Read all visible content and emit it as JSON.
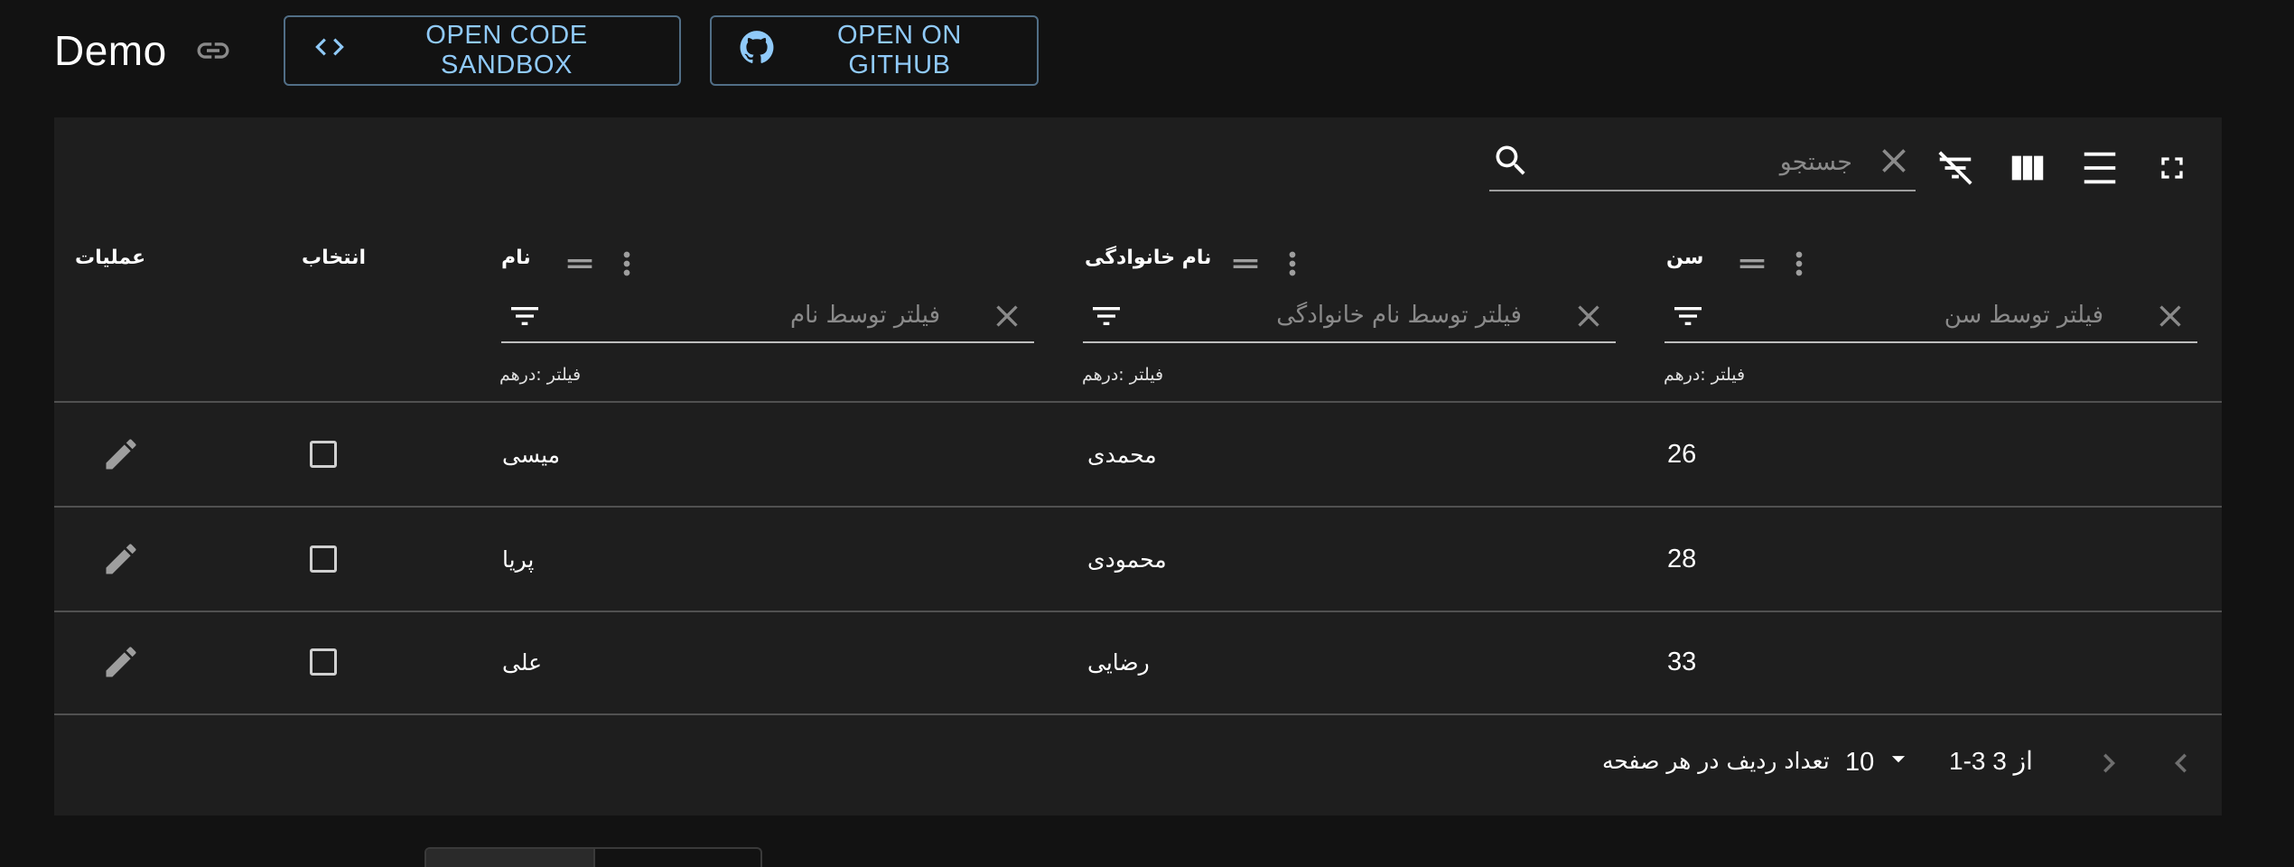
{
  "page": {
    "title": "Demo"
  },
  "buttons": {
    "sandbox": "OPEN CODE SANDBOX",
    "github": "OPEN ON GITHUB"
  },
  "toolbar": {
    "search_placeholder": "جستجو"
  },
  "columns": [
    {
      "header": "سن",
      "filter_placeholder": "فیلتر توسط سن",
      "filter_mode": "فیلتر :درهم"
    },
    {
      "header": "نام خانوادگی",
      "filter_placeholder": "فیلتر توسط نام خانوادگی",
      "filter_mode": "فیلتر :درهم"
    },
    {
      "header": "نام",
      "filter_placeholder": "فیلتر توسط نام",
      "filter_mode": "فیلتر :درهم"
    },
    {
      "header": "انتخاب"
    },
    {
      "header": "عملیات"
    }
  ],
  "rows": [
    {
      "age": "26",
      "last_name": "محمدی",
      "first_name": "میسی"
    },
    {
      "age": "28",
      "last_name": "محمودی",
      "first_name": "پریا"
    },
    {
      "age": "33",
      "last_name": "رضایی",
      "first_name": "علی"
    }
  ],
  "pagination": {
    "rows_per_page_label": "تعداد ردیف در هر صفحه",
    "rows_per_page": "10",
    "range_label": "از 3 3-1"
  },
  "colors": {
    "accent": "#90caf9",
    "background": "#121212",
    "paper": "#1e1e1e",
    "divider": "#515151"
  },
  "icons": [
    "link-icon",
    "code-icon",
    "github-icon",
    "search-icon",
    "clear-icon",
    "filter-off-icon",
    "view-column-icon",
    "density-icon",
    "fullscreen-icon",
    "filter-list-icon",
    "drag-handle-icon",
    "more-vert-icon",
    "edit-icon",
    "checkbox-icon",
    "arrow-drop-down-icon",
    "chevron-left-icon",
    "chevron-right-icon"
  ]
}
